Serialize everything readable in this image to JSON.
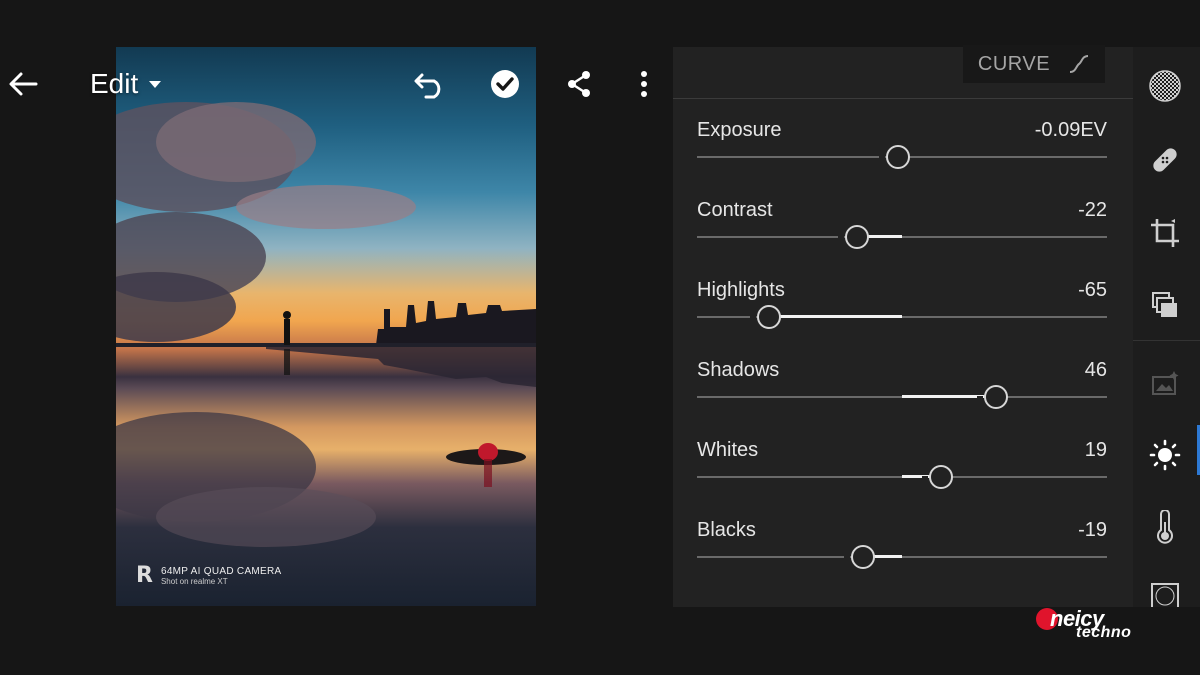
{
  "toolbar": {
    "mode_label": "Edit"
  },
  "photo": {
    "watermark_line1": "64MP AI QUAD CAMERA",
    "watermark_line2": "Shot on realme XT",
    "watermark_logo": "R"
  },
  "panel": {
    "tab_label": "CURVE",
    "sliders": [
      {
        "label": "Exposure",
        "value": "-0.09EV",
        "level": -0.02
      },
      {
        "label": "Contrast",
        "value": "-22",
        "level": -0.22
      },
      {
        "label": "Highlights",
        "value": "-65",
        "level": -0.65
      },
      {
        "label": "Shadows",
        "value": "46",
        "level": 0.46
      },
      {
        "label": "Whites",
        "value": "19",
        "level": 0.19
      },
      {
        "label": "Blacks",
        "value": "-19",
        "level": -0.19
      }
    ]
  },
  "rail": {
    "items": [
      {
        "icon": "presets-icon"
      },
      {
        "icon": "healing-icon"
      },
      {
        "icon": "crop-icon"
      },
      {
        "icon": "profiles-icon"
      },
      {
        "icon": "auto-icon"
      },
      {
        "icon": "light-icon",
        "active": true
      },
      {
        "icon": "color-icon"
      },
      {
        "icon": "effects-icon"
      }
    ]
  },
  "brand": {
    "line1": "neicy",
    "line2": "techno"
  },
  "colors": {
    "accent": "#2d79d4",
    "panel_bg": "#222222",
    "brand_red": "#e0142c"
  }
}
